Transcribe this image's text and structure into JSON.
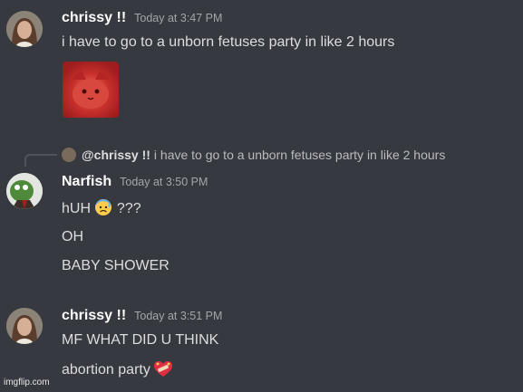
{
  "messages": [
    {
      "username": "chrissy !!",
      "timestamp": "Today at 3:47 PM",
      "lines": [
        "i have to go to a unborn fetuses party in like 2 hours"
      ],
      "attachment_icon": "red-cat-image"
    },
    {
      "reply": {
        "username": "@chrissy !!",
        "text": "i have to go to a unborn fetuses party in like 2 hours"
      },
      "username": "Narfish",
      "timestamp": "Today at 3:50 PM",
      "lines": [
        "hUH",
        "???",
        "OH",
        "BABY SHOWER"
      ],
      "emoji": "anxious-face-with-sweat"
    },
    {
      "username": "chrissy !!",
      "timestamp": "Today at 3:51 PM",
      "lines": [
        "MF WHAT DID U THINK",
        "abortion party"
      ],
      "emoji": "heart-with-bandage"
    }
  ],
  "watermark": "imgflip.com"
}
